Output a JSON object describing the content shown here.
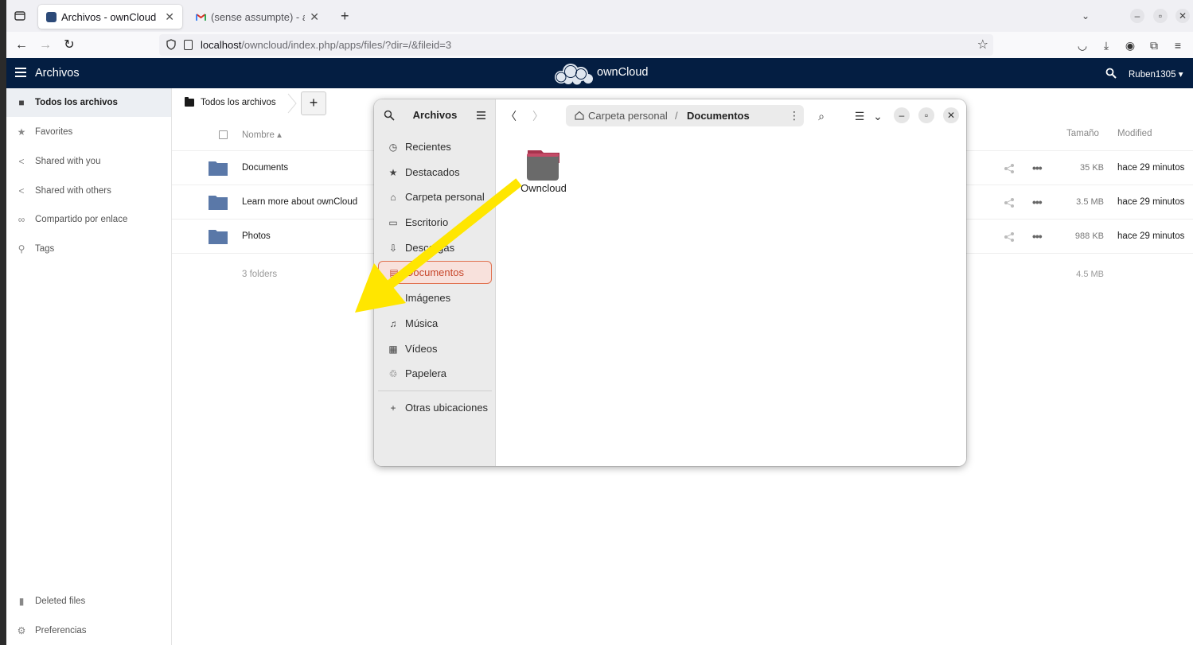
{
  "browser": {
    "tabs": [
      {
        "title": "Archivos - ownCloud",
        "active": true
      },
      {
        "title": "(sense assumpte) - alcan",
        "active": false
      }
    ],
    "url": {
      "host": "localhost",
      "path": "/owncloud/index.php/apps/files/?dir=/&fileid=3"
    }
  },
  "oc": {
    "app_title": "Archivos",
    "brand": "ownCloud",
    "user": "Ruben1305",
    "sidebar": [
      {
        "label": "Todos los archivos",
        "icon": "folder-icon"
      },
      {
        "label": "Favorites",
        "icon": "star-icon"
      },
      {
        "label": "Shared with you",
        "icon": "share-icon"
      },
      {
        "label": "Shared with others",
        "icon": "share-icon"
      },
      {
        "label": "Compartido por enlace",
        "icon": "link-icon"
      },
      {
        "label": "Tags",
        "icon": "search-icon"
      }
    ],
    "sidebar_bottom": [
      {
        "label": "Deleted files",
        "icon": "trash-icon"
      },
      {
        "label": "Preferencias",
        "icon": "gear-icon"
      }
    ],
    "breadcrumb": "Todos los archivos",
    "new_button": "+",
    "columns": {
      "name": "Nombre",
      "size": "Tamaño",
      "modified": "Modified"
    },
    "files": [
      {
        "name": "Documents",
        "size": "35 KB",
        "modified": "hace 29 minutos"
      },
      {
        "name": "Learn more about ownCloud",
        "size": "3.5 MB",
        "modified": "hace 29 minutos"
      },
      {
        "name": "Photos",
        "size": "988 KB",
        "modified": "hace 29 minutos"
      }
    ],
    "summary": {
      "count": "3 folders",
      "size": "4.5 MB"
    }
  },
  "nautilus": {
    "title": "Archivos",
    "places": [
      {
        "label": "Recientes",
        "icon": "clock-icon"
      },
      {
        "label": "Destacados",
        "icon": "star-icon"
      },
      {
        "label": "Carpeta personal",
        "icon": "home-icon"
      },
      {
        "label": "Escritorio",
        "icon": "desktop-icon"
      },
      {
        "label": "Descargas",
        "icon": "download-icon"
      },
      {
        "label": "Documentos",
        "icon": "document-icon",
        "selected": true
      },
      {
        "label": "Imágenes",
        "icon": "image-icon"
      },
      {
        "label": "Música",
        "icon": "music-icon"
      },
      {
        "label": "Vídeos",
        "icon": "video-icon"
      },
      {
        "label": "Papelera",
        "icon": "trash-icon"
      }
    ],
    "other_locations": "Otras ubicaciones",
    "path": [
      "Carpeta personal",
      "Documentos"
    ],
    "items": [
      {
        "name": "Owncloud",
        "icon": "folder-icon"
      }
    ]
  },
  "colors": {
    "oc_header": "#041e42",
    "oc_folder": "#5a78a8",
    "nautilus_selected_border": "#e0704e",
    "arrow": "#ffe600"
  }
}
